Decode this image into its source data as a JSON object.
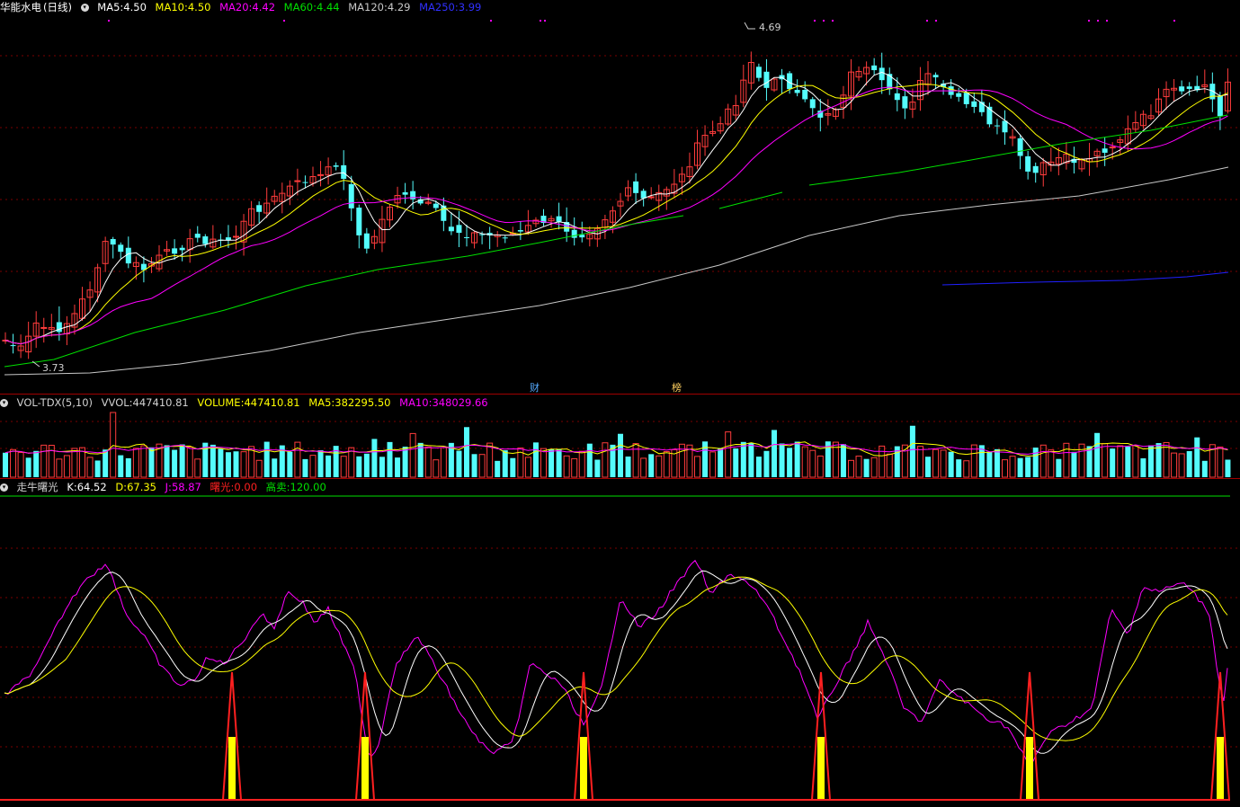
{
  "header": {
    "stock_name": "华能水电",
    "period": "(日线)",
    "ma5_label": "MA5:",
    "ma5_value": "4.50",
    "ma10_label": "MA10:",
    "ma10_value": "4.50",
    "ma20_label": "MA20:",
    "ma20_value": "4.42",
    "ma60_label": "MA60:",
    "ma60_value": "4.44",
    "ma120_label": "MA120:",
    "ma120_value": "4.29",
    "ma250_label": "MA250:",
    "ma250_value": "3.99"
  },
  "price_annotations": {
    "high": "4.69",
    "low": "3.73"
  },
  "event_markers": {
    "cai": "财",
    "bang": "榜"
  },
  "volume": {
    "indicator": "VOL-TDX(5,10)",
    "vvol_label": "VVOL:",
    "vvol_value": "447410.81",
    "volume_label": "VOLUME:",
    "volume_value": "447410.81",
    "ma5_label": "MA5:",
    "ma5_value": "382295.50",
    "ma10_label": "MA10:",
    "ma10_value": "348029.66"
  },
  "indicator": {
    "name": "走牛曙光",
    "k_label": "K:",
    "k_value": "64.52",
    "d_label": "D:",
    "d_value": "67.35",
    "j_label": "J:",
    "j_value": "58.87",
    "shuguang_label": "曙光:",
    "shuguang_value": "0.00",
    "gaomai_label": "高卖:",
    "gaomai_value": "120.00"
  },
  "colors": {
    "up": "#ff3c3c",
    "down": "#54fcfc",
    "ma5": "#ffffff",
    "ma10": "#ffff00",
    "ma20": "#ff00ff",
    "ma60": "#00e000",
    "ma120": "#c8c8c8",
    "ma250": "#2020ff",
    "grid": "#7a0000"
  }
}
